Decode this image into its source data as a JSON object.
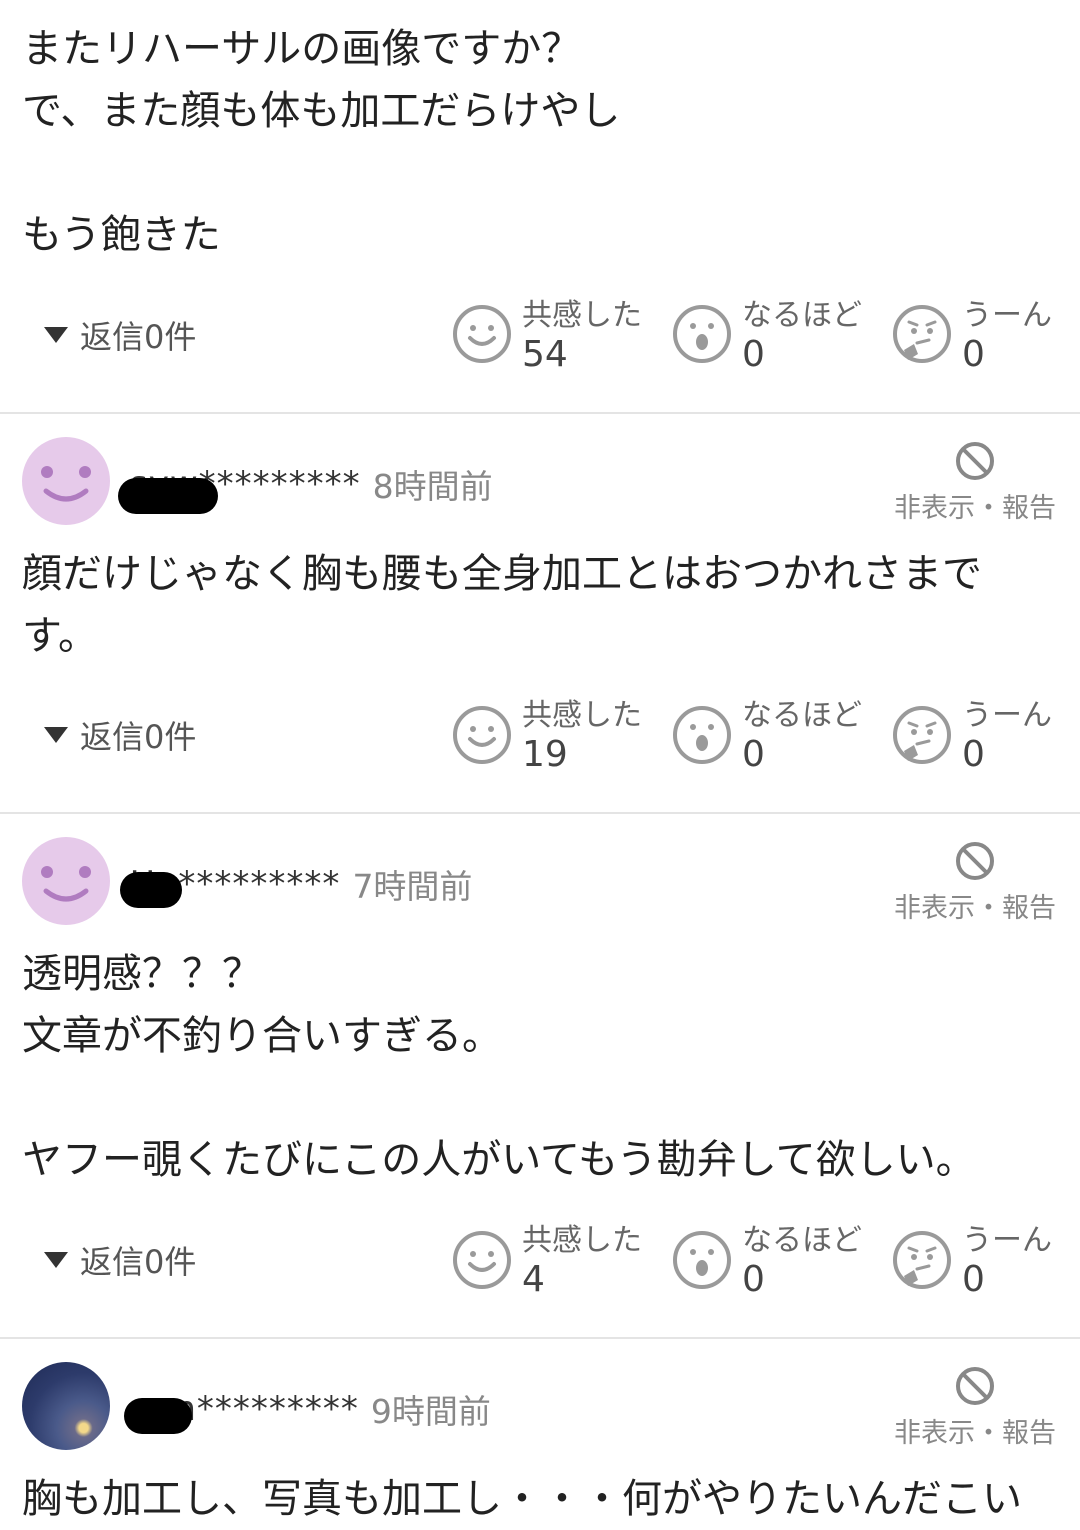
{
  "comments": [
    {
      "body": "またリハーサルの画像ですか？\nで、また顔も体も加工だらけやし\n\nもう飽きた",
      "reply": "返信0件",
      "reactions": {
        "kyokan_label": "共感した",
        "kyokan_count": "54",
        "naruhodo_label": "なるほど",
        "naruhodo_count": "0",
        "uun_label": "うーん",
        "uun_count": "0"
      }
    },
    {
      "user": "syw*********",
      "time": "8時間前",
      "hide_report": "非表示・報告",
      "body": "顔だけじゃなく胸も腰も全身加工とはおつかれさまで\nす。",
      "reply": "返信0件",
      "reactions": {
        "kyokan_label": "共感した",
        "kyokan_count": "19",
        "naruhodo_label": "なるほど",
        "naruhodo_count": "0",
        "uun_label": "うーん",
        "uun_count": "0"
      }
    },
    {
      "user": "Uu*********",
      "time": "7時間前",
      "hide_report": "非表示・報告",
      "body": "透明感？？？\n文章が不釣り合いすぎる。\n\nヤフー覗くたびにこの人がいてもう勘弁して欲しい。",
      "reply": "返信0件",
      "reactions": {
        "kyokan_label": "共感した",
        "kyokan_count": "4",
        "naruhodo_label": "なるほど",
        "naruhodo_count": "0",
        "uun_label": "うーん",
        "uun_count": "0"
      }
    },
    {
      "user": "uon*********",
      "time": "9時間前",
      "hide_report": "非表示・報告",
      "body": "胸も加工し、写真も加工し・・・何がやりたいんだこい"
    }
  ],
  "icons": {
    "reply_toggle": "triangle-down-icon",
    "kyokan": "smile-face-icon",
    "naruhodo": "surprised-face-icon",
    "uun": "thinking-face-icon",
    "hide": "ban-icon"
  },
  "colors": {
    "avatar_bg": "#e6caea",
    "avatar_face": "#b07cc0",
    "icon_gray": "#9a9a9a",
    "divider": "#e4e4e4"
  }
}
